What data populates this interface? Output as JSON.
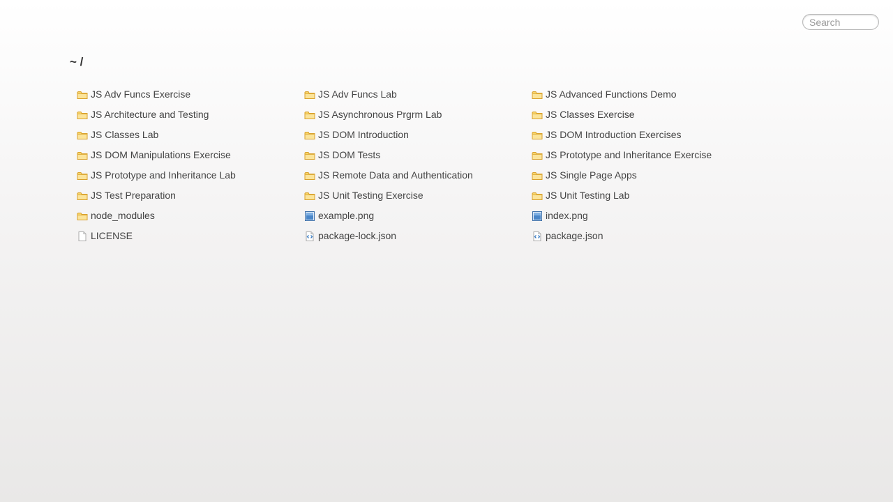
{
  "search": {
    "placeholder": "Search"
  },
  "breadcrumb": {
    "text": "~ /"
  },
  "items": [
    {
      "name": "JS Adv Funcs Exercise",
      "icon": "folder-icon"
    },
    {
      "name": "JS Adv Funcs Lab",
      "icon": "folder-icon"
    },
    {
      "name": "JS Advanced Functions Demo",
      "icon": "folder-icon"
    },
    {
      "name": "JS Architecture and Testing",
      "icon": "folder-icon"
    },
    {
      "name": "JS Asynchronous Prgrm Lab",
      "icon": "folder-icon"
    },
    {
      "name": "JS Classes Exercise",
      "icon": "folder-icon"
    },
    {
      "name": "JS Classes Lab",
      "icon": "folder-icon"
    },
    {
      "name": "JS DOM Introduction",
      "icon": "folder-icon"
    },
    {
      "name": "JS DOM Introduction Exercises",
      "icon": "folder-icon"
    },
    {
      "name": "JS DOM Manipulations Exercise",
      "icon": "folder-icon"
    },
    {
      "name": "JS DOM Tests",
      "icon": "folder-icon"
    },
    {
      "name": "JS Prototype and Inheritance Exercise",
      "icon": "folder-icon"
    },
    {
      "name": "JS Prototype and Inheritance Lab",
      "icon": "folder-icon"
    },
    {
      "name": "JS Remote Data and Authentication",
      "icon": "folder-icon"
    },
    {
      "name": "JS Single Page Apps",
      "icon": "folder-icon"
    },
    {
      "name": "JS Test Preparation",
      "icon": "folder-icon"
    },
    {
      "name": "JS Unit Testing Exercise",
      "icon": "folder-icon"
    },
    {
      "name": "JS Unit Testing Lab",
      "icon": "folder-icon"
    },
    {
      "name": "node_modules",
      "icon": "folder-icon"
    },
    {
      "name": "example.png",
      "icon": "image-icon"
    },
    {
      "name": "index.png",
      "icon": "image-icon"
    },
    {
      "name": "LICENSE",
      "icon": "file-icon"
    },
    {
      "name": "package-lock.json",
      "icon": "code-file-icon"
    },
    {
      "name": "package.json",
      "icon": "code-file-icon"
    }
  ]
}
